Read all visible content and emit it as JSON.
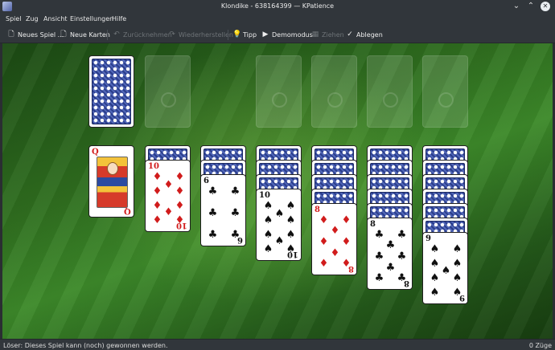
{
  "window": {
    "title": "Klondike - 638164399 — KPatience"
  },
  "menu": [
    "Spiel",
    "Zug",
    "Ansicht",
    "Einstellungen",
    "Hilfe"
  ],
  "toolbar": {
    "new_game": "Neues Spiel ...",
    "new_cards": "Neue Karten",
    "undo": "Zurücknehmen",
    "redo": "Wiederherstellen",
    "hint": "Tipp",
    "demo": "Demomodus",
    "draw": "Ziehen",
    "deal": "Ablegen"
  },
  "tableau_top_cards": [
    {
      "rank": "Q",
      "suit": "♦",
      "color": "red"
    },
    {
      "rank": "10",
      "suit": "♦",
      "color": "red"
    },
    {
      "rank": "6",
      "suit": "♣",
      "color": "black"
    },
    {
      "rank": "10",
      "suit": "♠",
      "color": "black"
    },
    {
      "rank": "8",
      "suit": "♦",
      "color": "red"
    },
    {
      "rank": "8",
      "suit": "♣",
      "color": "black"
    },
    {
      "rank": "9",
      "suit": "♠",
      "color": "black"
    }
  ],
  "tableau_hidden_counts": [
    0,
    1,
    2,
    3,
    4,
    5,
    6
  ],
  "status": {
    "message": "Löser: Dieses Spiel kann (noch) gewonnen werden.",
    "moves": "0 Züge"
  },
  "colors": {
    "felt": "#2f6e1f",
    "card_back": "#2b3e8c",
    "chrome": "#31363b"
  }
}
